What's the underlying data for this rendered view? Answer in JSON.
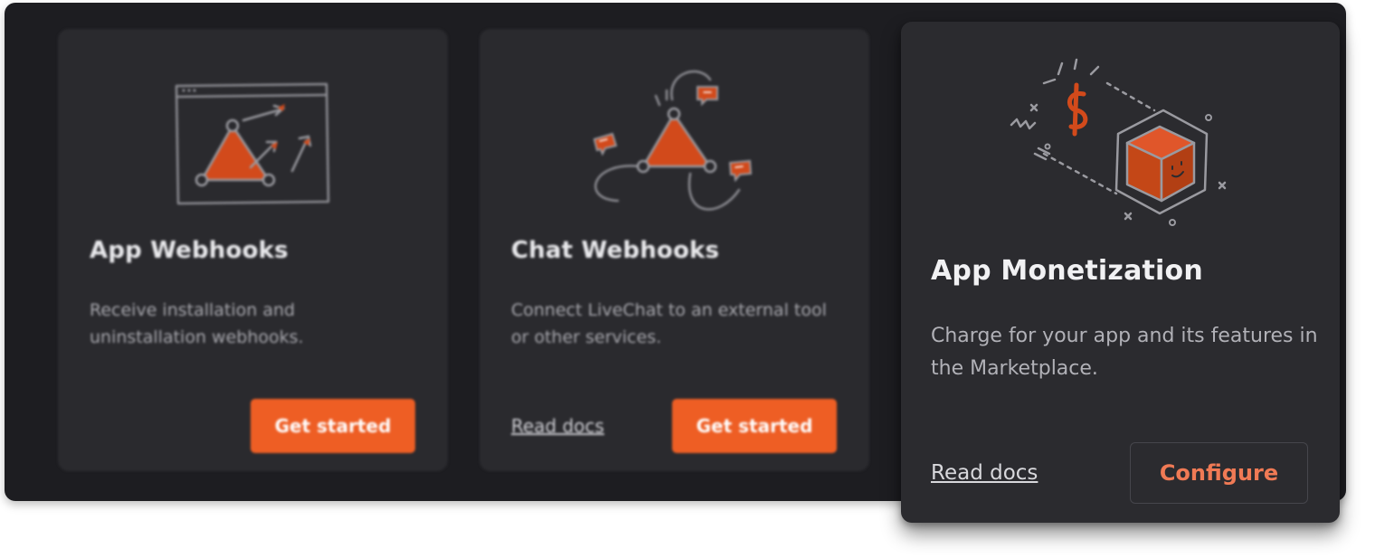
{
  "cards": [
    {
      "title": "App Webhooks",
      "description": "Receive installation and uninstallation webhooks.",
      "primary_label": "Get started"
    },
    {
      "title": "Chat Webhooks",
      "description": "Connect LiveChat to an external tool or other services.",
      "link_label": "Read docs",
      "primary_label": "Get started"
    },
    {
      "title": "App Monetization",
      "description": "Charge for your app and its features in the Marketplace.",
      "link_label": "Read docs",
      "primary_label": "Configure"
    }
  ],
  "colors": {
    "panel_bg": "#1d1d21",
    "card_bg": "#2a2a2e",
    "accent": "#ee5e24",
    "configure_text": "#f07a55"
  }
}
